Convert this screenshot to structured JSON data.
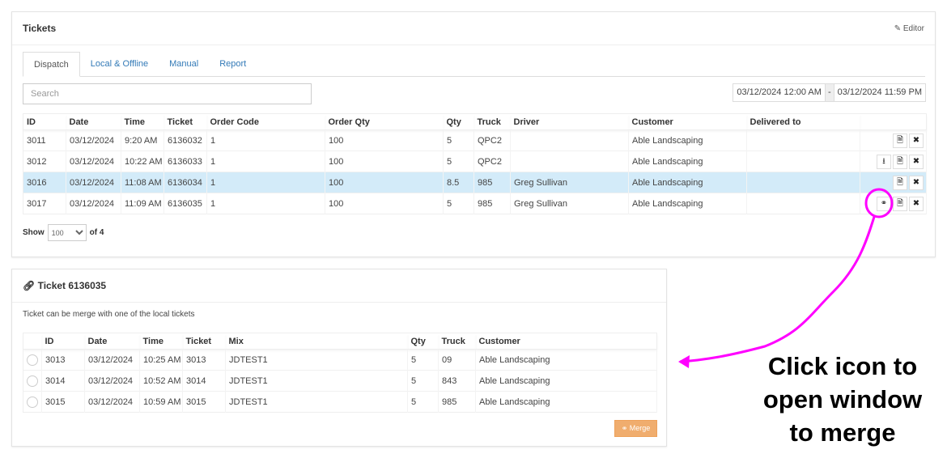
{
  "tickets_panel": {
    "title": "Tickets",
    "editor_label": "Editor",
    "tabs": [
      {
        "label": "Dispatch",
        "active": true
      },
      {
        "label": "Local & Offline"
      },
      {
        "label": "Manual"
      },
      {
        "label": "Report"
      }
    ],
    "search_placeholder": "Search",
    "date_from": "03/12/2024 12:00 AM",
    "date_sep": "-",
    "date_to": "03/12/2024 11:59 PM",
    "columns": [
      "ID",
      "Date",
      "Time",
      "Ticket",
      "Order Code",
      "Order Qty",
      "Qty",
      "Truck",
      "Driver",
      "Customer",
      "Delivered to"
    ],
    "rows": [
      {
        "cells": [
          "3011",
          "03/12/2024",
          "9:20 AM",
          "6136032",
          "1",
          "100",
          "5",
          "QPC2",
          "",
          "Able Landscaping",
          ""
        ],
        "actions": [
          "document",
          "delete"
        ]
      },
      {
        "cells": [
          "3012",
          "03/12/2024",
          "10:22 AM",
          "6136033",
          "1",
          "100",
          "5",
          "QPC2",
          "",
          "Able Landscaping",
          ""
        ],
        "actions": [
          "download",
          "document",
          "delete"
        ]
      },
      {
        "cells": [
          "3016",
          "03/12/2024",
          "11:08 AM",
          "6136034",
          "1",
          "100",
          "8.5",
          "985",
          "Greg Sullivan",
          "Able Landscaping",
          ""
        ],
        "actions": [
          "document",
          "delete"
        ],
        "selected": true
      },
      {
        "cells": [
          "3017",
          "03/12/2024",
          "11:09 AM",
          "6136035",
          "1",
          "100",
          "5",
          "985",
          "Greg Sullivan",
          "Able Landscaping",
          ""
        ],
        "actions": [
          "link",
          "document",
          "delete"
        ]
      }
    ],
    "show_label": "Show",
    "page_size": "100",
    "of_label": "of 4"
  },
  "merge_panel": {
    "title": "Ticket 6136035",
    "hint": "Ticket can be merge with one of the local tickets",
    "columns": [
      "",
      "ID",
      "Date",
      "Time",
      "Ticket",
      "Mix",
      "Qty",
      "Truck",
      "Customer"
    ],
    "rows": [
      [
        "3013",
        "03/12/2024",
        "10:25 AM",
        "3013",
        "JDTEST1",
        "5",
        "09",
        "Able Landscaping"
      ],
      [
        "3014",
        "03/12/2024",
        "10:52 AM",
        "3014",
        "JDTEST1",
        "5",
        "843",
        "Able Landscaping"
      ],
      [
        "3015",
        "03/12/2024",
        "10:59 AM",
        "3015",
        "JDTEST1",
        "5",
        "985",
        "Able Landscaping"
      ]
    ],
    "merge_label": "Merge"
  },
  "annotation": {
    "lines": [
      "Click icon to",
      "open window",
      "to merge"
    ],
    "color": "#ff00ff"
  },
  "colors": {
    "selected_row": "#d3ebf9",
    "link": "#337ab7",
    "merge_button": "#f0ad6e"
  }
}
